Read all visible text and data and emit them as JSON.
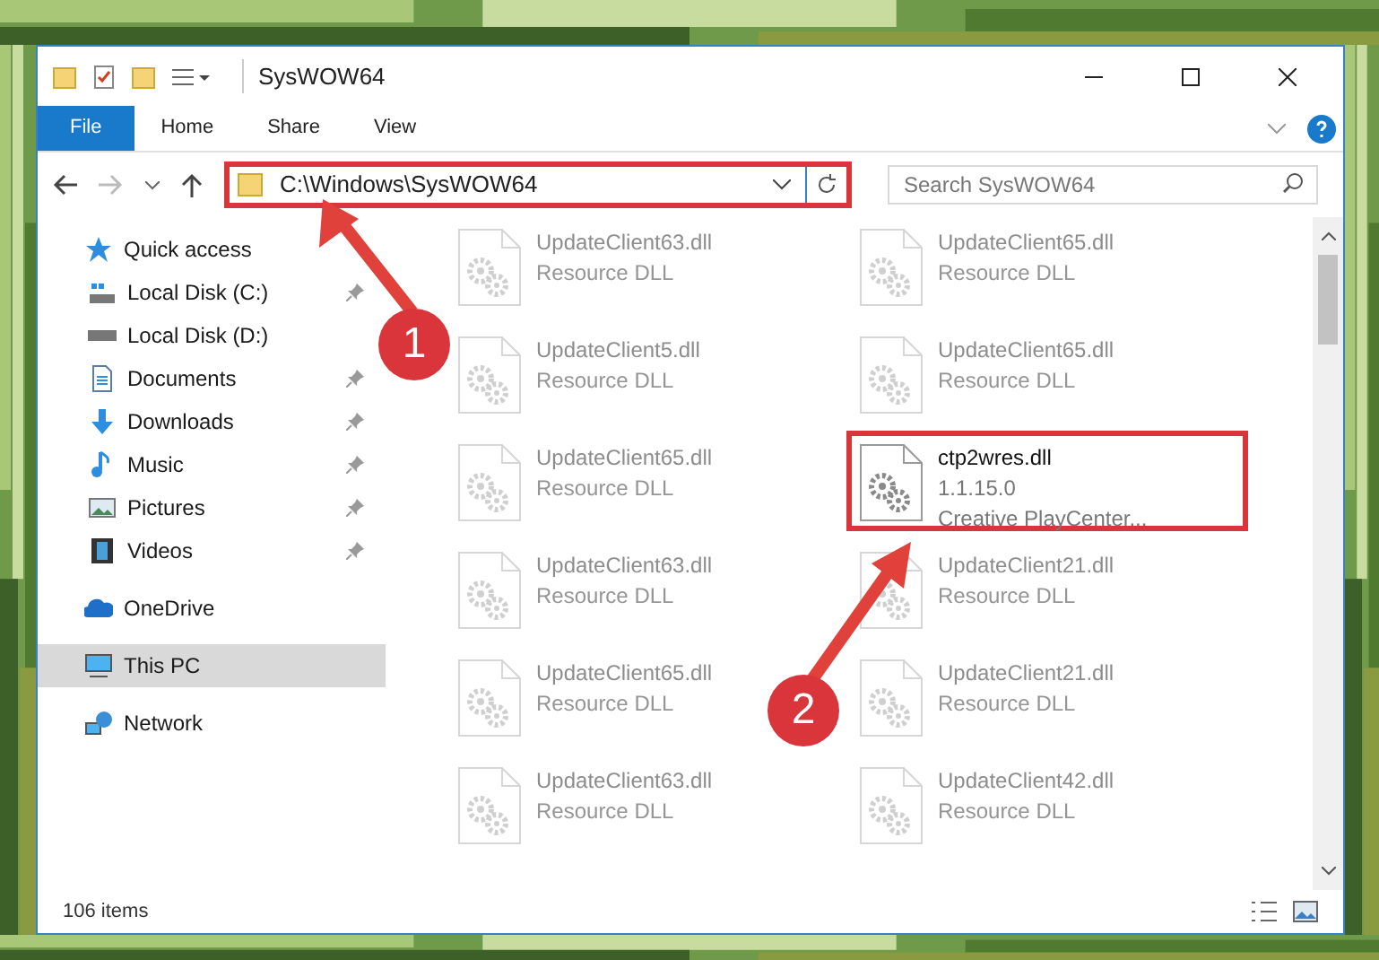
{
  "window": {
    "title": "SysWOW64"
  },
  "ribbon_tabs": [
    {
      "label": "File",
      "kind": "file"
    },
    {
      "label": "Home",
      "kind": "tab"
    },
    {
      "label": "Share",
      "kind": "tab"
    },
    {
      "label": "View",
      "kind": "tab"
    }
  ],
  "address_bar": {
    "value": "C:\\Windows\\SysWOW64",
    "highlighted": true
  },
  "search": {
    "placeholder": "Search SysWOW64"
  },
  "sidebar": {
    "items": [
      {
        "label": "Quick access",
        "kind": "star",
        "selected": false,
        "children": [
          {
            "label": "Local Disk (C:)",
            "kind": "disk-c",
            "pinned": true,
            "selected": false
          },
          {
            "label": "Local Disk (D:)",
            "kind": "disk",
            "pinned": false,
            "selected": false
          },
          {
            "label": "Documents",
            "kind": "documents",
            "pinned": true,
            "selected": false
          },
          {
            "label": "Downloads",
            "kind": "downloads",
            "pinned": true,
            "selected": false
          },
          {
            "label": "Music",
            "kind": "music",
            "pinned": true,
            "selected": false
          },
          {
            "label": "Pictures",
            "kind": "pictures",
            "pinned": true,
            "selected": false
          },
          {
            "label": "Videos",
            "kind": "videos",
            "pinned": true,
            "selected": false
          }
        ]
      },
      {
        "label": "OneDrive",
        "kind": "cloud",
        "selected": false
      },
      {
        "label": "This PC",
        "kind": "pc",
        "selected": true
      },
      {
        "label": "Network",
        "kind": "network",
        "selected": false
      }
    ]
  },
  "files": [
    {
      "name": "UpdateClient63.dll",
      "type": "Resource DLL",
      "faded": true,
      "highlighted": false
    },
    {
      "name": "UpdateClient65.dll",
      "type": "Resource DLL",
      "faded": true,
      "highlighted": false
    },
    {
      "name": "UpdateClient5.dll",
      "type": "Resource DLL",
      "faded": true,
      "highlighted": false
    },
    {
      "name": "UpdateClient65.dll",
      "type": "Resource DLL",
      "faded": true,
      "highlighted": false
    },
    {
      "name": "UpdateClient65.dll",
      "type": "Resource DLL",
      "faded": true,
      "highlighted": false
    },
    {
      "name": "ctp2wres.dll",
      "type": "1.1.15.0",
      "description": "Creative PlayCenter...",
      "faded": false,
      "highlighted": true
    },
    {
      "name": "UpdateClient63.dll",
      "type": "Resource DLL",
      "faded": true,
      "highlighted": false
    },
    {
      "name": "UpdateClient21.dll",
      "type": "Resource DLL",
      "faded": true,
      "highlighted": false
    },
    {
      "name": "UpdateClient65.dll",
      "type": "Resource DLL",
      "faded": true,
      "highlighted": false
    },
    {
      "name": "UpdateClient21.dll",
      "type": "Resource DLL",
      "faded": true,
      "highlighted": false
    },
    {
      "name": "UpdateClient63.dll",
      "type": "Resource DLL",
      "faded": true,
      "highlighted": false
    },
    {
      "name": "UpdateClient42.dll",
      "type": "Resource DLL",
      "faded": true,
      "highlighted": false
    }
  ],
  "status_bar": {
    "item_count": "106 items"
  },
  "callouts": [
    {
      "number": "1"
    },
    {
      "number": "2"
    }
  ]
}
